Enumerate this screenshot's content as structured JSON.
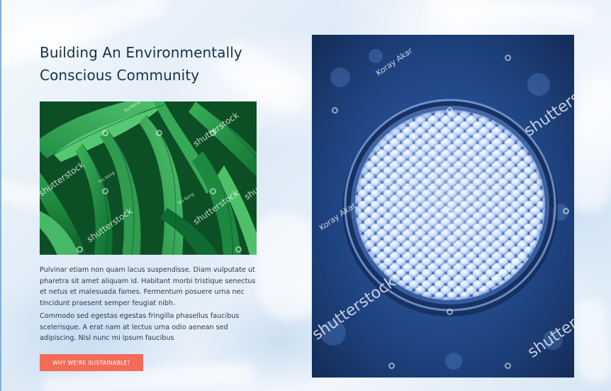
{
  "heading": "Building An Environmentally Conscious Community",
  "paragraphs": [
    "Pulvinar etiam non quam lacus suspendisse. Diam vulputate ut pharetra sit amet aliquam id. Habitant morbi tristique senectus et netus et malesuada fames. Fermentum posuere urna nec tincidunt praesent semper feugiat nibh.",
    "Commodo sed egestas egestas fringilla phasellus faucibus scelerisque. A erat nam at lectus urna odio aenean sed adipiscing. Nisl nunc mi ipsum faucibus"
  ],
  "cta_label": "WHY WE'RE SUSTAINABLE?",
  "watermarks": {
    "brand": "shutterstock",
    "author_pellets": "Koray Akar",
    "author_leaves": "Thi Kong"
  },
  "colors": {
    "heading": "#16324a",
    "body_text": "#2e3a44",
    "cta_background": "#f46b58",
    "cta_text": "#ffffff"
  },
  "images": {
    "left": "green-leaves-photo",
    "right": "plastic-pellets-in-bowl-photo"
  }
}
